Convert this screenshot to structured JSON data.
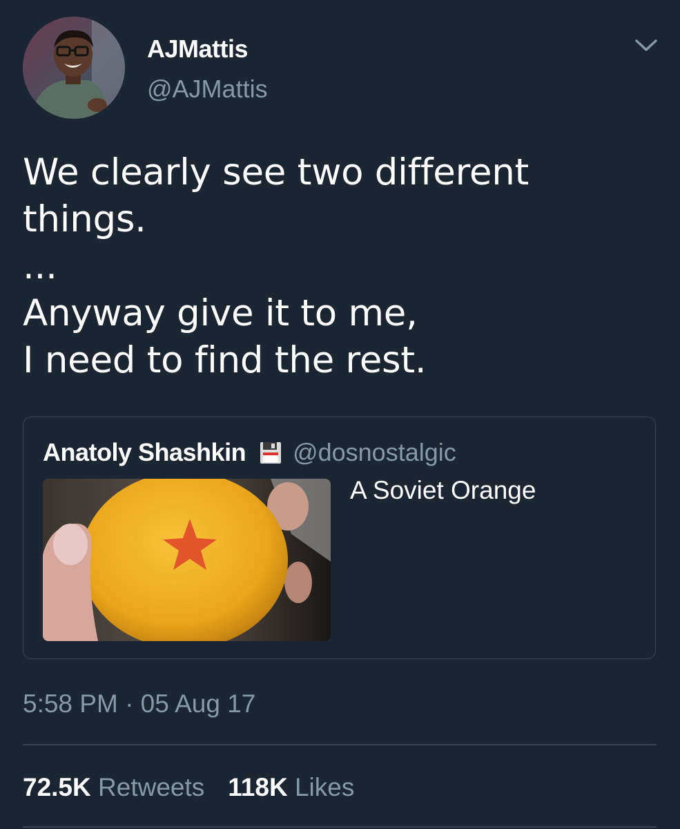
{
  "author": {
    "display_name": "AJMattis",
    "handle": "@AJMattis",
    "avatar_icon": "user-avatar-photo"
  },
  "tweet": {
    "text": "We clearly see two different\nthings.\n...\nAnyway give it to me,\nI need to find the rest."
  },
  "quoted_tweet": {
    "author_name": "Anatoly Shashkin",
    "author_badge_icon": "floppy-disk-icon",
    "author_handle": "@dosnostalgic",
    "text": "A Soviet Orange",
    "image": "orange-with-red-star-photo"
  },
  "meta": {
    "timestamp": "5:58 PM · 05 Aug 17"
  },
  "stats": {
    "retweets_count": "72.5K",
    "retweets_label": "Retweets",
    "likes_count": "118K",
    "likes_label": "Likes"
  },
  "colors": {
    "background": "#1c2532",
    "text_primary": "#ffffff",
    "text_secondary": "#8899a6",
    "border": "#38444d"
  }
}
